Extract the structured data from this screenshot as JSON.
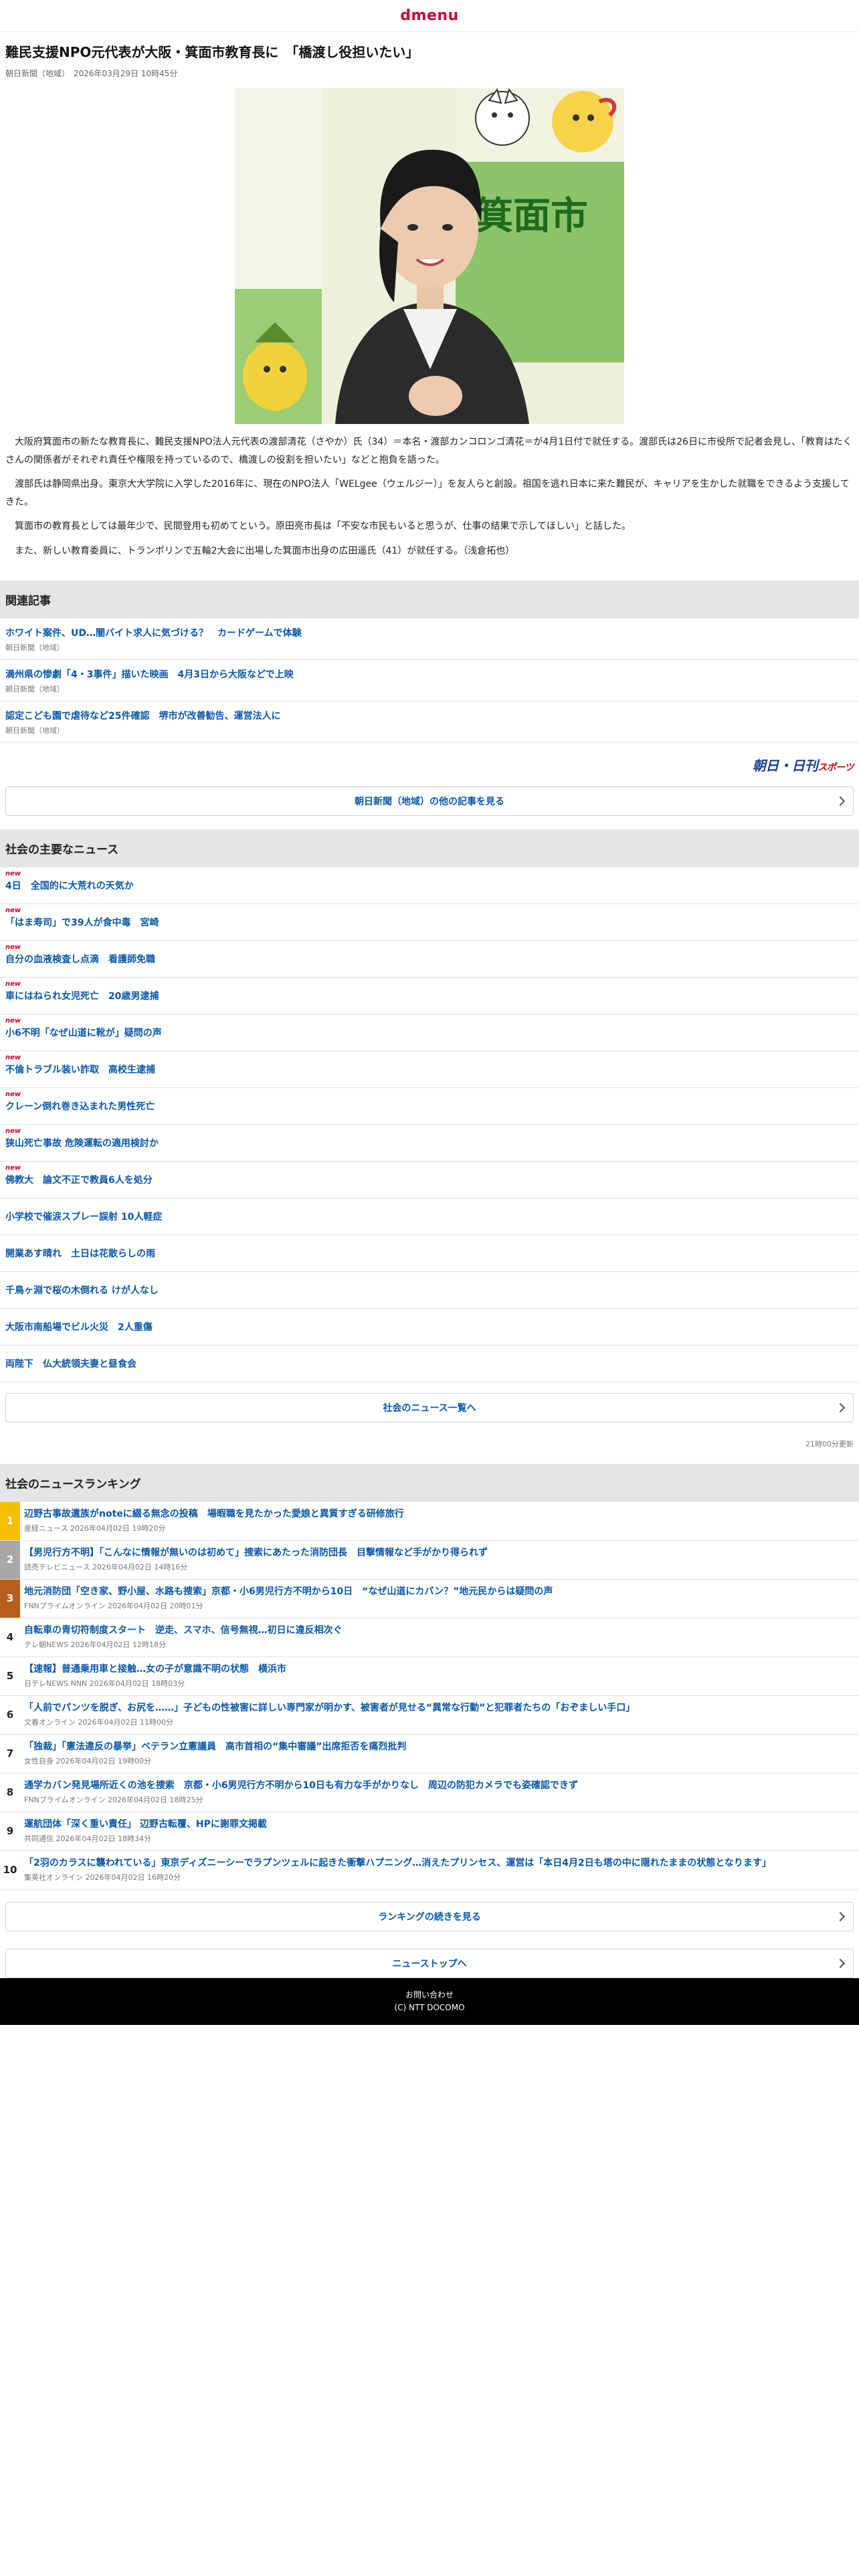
{
  "brand": {
    "logo": "dmenu"
  },
  "article": {
    "headline": "難民支援NPO元代表が大阪・箕面市教育長に　「橋渡し役担いたい」",
    "meta": "朝日新聞（地域）　2026年03月29日 10時45分",
    "photo_sign": "箕面市",
    "paragraphs": [
      "大阪府箕面市の新たな教育長に、難民支援NPO法人元代表の渡部清花（さやか）氏（34）＝本名・渡部カンコロンゴ清花＝が4月1日付で就任する。渡部氏は26日に市役所で記者会見し、「教育はたくさんの関係者がそれぞれ責任や権限を持っているので、橋渡しの役割を担いたい」などと抱負を語った。",
      "渡部氏は静岡県出身。東京大大学院に入学した2016年に、現在のNPO法人「WELgee（ウェルジー）」を友人らと創設。祖国を逃れ日本に来た難民が、キャリアを生かした就職をできるよう支援してきた。",
      "箕面市の教育長としては最年少で、民間登用も初めてという。原田亮市長は「不安な市民もいると思うが、仕事の結果で示してほしい」と話した。",
      "また、新しい教育委員に、トランポリンで五輪2大会に出場した箕面市出身の広田遥氏（41）が就任する。（浅倉拓也）"
    ]
  },
  "related": {
    "header": "関連記事",
    "items": [
      {
        "title": "ホワイト案件、UD…闇バイト求人に気づける？　カードゲームで体験",
        "source": "朝日新聞（地域）"
      },
      {
        "title": "満州県の惨劇「4・3事件」描いた映画　4月3日から大阪などで上映",
        "source": "朝日新聞（地域）"
      },
      {
        "title": "認定こども園で虐待など25件確認　堺市が改善勧告、運営法人に",
        "source": "朝日新聞（地域）"
      }
    ],
    "brand_badge_main": "朝日・日刊",
    "brand_badge_sub": "スポーツ",
    "more_label": "朝日新聞（地域）の他の記事を見る"
  },
  "society": {
    "header": "社会の主要なニュース",
    "new_label": "new",
    "items": [
      {
        "title": "4日　全国的に大荒れの天気か",
        "is_new": true
      },
      {
        "title": "「はま寿司」で39人が食中毒　宮崎",
        "is_new": true
      },
      {
        "title": "自分の血液検査し点滴　看護師免職",
        "is_new": true
      },
      {
        "title": "車にはねられ女児死亡　20歳男逮捕",
        "is_new": true
      },
      {
        "title": "小6不明「なぜ山道に靴が」疑問の声",
        "is_new": true
      },
      {
        "title": "不倫トラブル装い詐取　高校生逮捕",
        "is_new": true
      },
      {
        "title": "クレーン倒れ巻き込まれた男性死亡",
        "is_new": true
      },
      {
        "title": "狭山死亡事故 危険運転の適用検討か",
        "is_new": true
      },
      {
        "title": "佛教大　論文不正で教員6人を処分",
        "is_new": true
      },
      {
        "title": "小学校で催涙スプレー誤射 10人軽症",
        "is_new": false
      },
      {
        "title": "開業あす晴れ　土日は花散らしの雨",
        "is_new": false
      },
      {
        "title": "千鳥ヶ淵で桜の木倒れる けが人なし",
        "is_new": false
      },
      {
        "title": "大阪市南船場でビル火災　2人重傷",
        "is_new": false
      },
      {
        "title": "両陛下　仏大統領夫妻と昼食会",
        "is_new": false
      }
    ],
    "more_label": "社会のニュース一覧へ",
    "updated": "21時00分更新"
  },
  "ranking": {
    "header": "社会のニュースランキング",
    "items": [
      {
        "rank": "1",
        "title": "辺野古事故遺族がnoteに綴る無念の投稿　場暇職を見たかった愛娘と異質すぎる研修旅行",
        "meta": "産経ニュース 2026年04月02日 19時20分"
      },
      {
        "rank": "2",
        "title": "【男児行方不明】「こんなに情報が無いのは初めて」捜索にあたった消防団長　目撃情報など手がかり得られず",
        "meta": "読売テレビニュース 2026年04月02日 14時16分"
      },
      {
        "rank": "3",
        "title": "地元消防団「空き家、野小屋、水路も捜索」京都・小6男児行方不明から10日　“なぜ山道にカバン？”地元民からは疑問の声",
        "meta": "FNNプライムオンライン 2026年04月02日 20時01分"
      },
      {
        "rank": "4",
        "title": "自転車の青切符制度スタート　逆走、スマホ、信号無視…初日に違反相次ぐ",
        "meta": "テレ朝NEWS 2026年04月02日 12時18分"
      },
      {
        "rank": "5",
        "title": "【速報】普通乗用車と接触…女の子が意識不明の状態　横浜市",
        "meta": "日テレNEWS NNN 2026年04月02日 18時03分"
      },
      {
        "rank": "6",
        "title": "「人前でパンツを脱ぎ、お尻を……」子どもの性被害に詳しい専門家が明かす、被害者が見せる“異常な行動”と犯罪者たちの「おぞましい手口」",
        "meta": "文春オンライン 2026年04月02日 11時00分"
      },
      {
        "rank": "7",
        "title": "「独裁」「憲法違反の暴挙」ベテラン立憲議員　高市首相の“集中審議”出席拒否を痛烈批判",
        "meta": "女性自身 2026年04月02日 19時00分"
      },
      {
        "rank": "8",
        "title": "通学カバン発見場所近くの池を捜索　京都・小6男児行方不明から10日も有力な手がかりなし　周辺の防犯カメラでも姿確認できず",
        "meta": "FNNプライムオンライン 2026年04月02日 18時25分"
      },
      {
        "rank": "9",
        "title": "運航団体「深く重い責任」 辺野古転覆、HPに謝罪文掲載",
        "meta": "共同通信 2026年04月02日 18時34分"
      },
      {
        "rank": "10",
        "title": "「2羽のカラスに襲われている」東京ディズニーシーでラプンツェルに起きた衝撃ハプニング…消えたプリンセス、運営は「本日4月2日も塔の中に隠れたままの状態となります」",
        "meta": "集英社オンライン 2026年04月02日 16時20分"
      }
    ],
    "more_label": "ランキングの続きを見る",
    "top_label": "ニューストップへ"
  },
  "footer": {
    "contact": "お問い合わせ",
    "copyright": "(C) NTT DOCOMO"
  }
}
